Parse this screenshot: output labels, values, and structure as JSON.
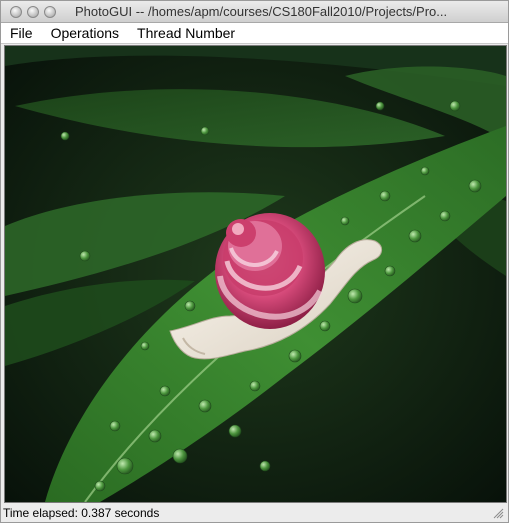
{
  "window": {
    "title": "PhotoGUI -- /homes/apm/courses/CS180Fall2010/Projects/Pro..."
  },
  "menu": {
    "items": [
      {
        "label": "File"
      },
      {
        "label": "Operations"
      },
      {
        "label": "Thread Number"
      }
    ]
  },
  "image": {
    "subject": "snail-on-wet-leaf-photo"
  },
  "status": {
    "text": "Time elapsed: 0.387 seconds"
  },
  "colors": {
    "leaf": "#2f7a2a",
    "background": "#0f1d10",
    "snail_shell": "#d64a7a",
    "snail_body": "#f2ebe0"
  }
}
